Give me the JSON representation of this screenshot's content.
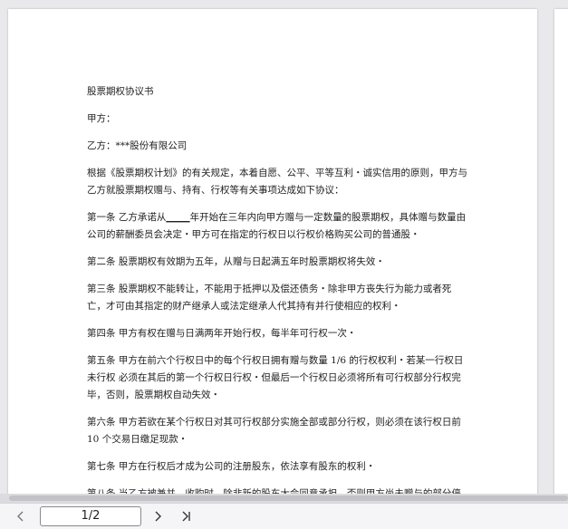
{
  "document": {
    "title": "股票期权协议书",
    "party_a": "甲方：",
    "party_b": "乙方：***股份有限公司",
    "intro": "根据《股票期权计划》的有关规定，本着自愿、公平、平等互利・诚实信用的原则，甲方与乙方就股票期权赠与、持有、行权等有关事项达成如下协议：",
    "a1_pre": "第一条 乙方承诺从",
    "a1_blank": "_____",
    "a1_post": "年开始在三年内向甲方赠与一定数量的股票期权，具体赠与数量由公司的薪酬委员会决定・甲方可在指定的行权日以行权价格购买公司的普通股・",
    "a2": "第二条 股票期权有效期为五年，从赠与日起满五年时股票期权将失效・",
    "a3": "第三条 股票期权不能转让，不能用于抵押以及偿还债务・除非甲方丧失行为能力或者死亡，才可由其指定的财产继承人或法定继承人代其持有并行使相应的权利・",
    "a4": "第四条 甲方有权在赠与日满两年开始行权，每半年可行权一次・",
    "a5": "第五条 甲方在前六个行权日中的每个行权日拥有赠与数量 1/6 的行权权利・若某一行权日未行权 必须在其后的第一个行权日行权・但最后一个行权日必须将所有可行权部分行权完毕，否则，股票期权自动失效・",
    "a6": "第六条 甲方若欲在某个行权日对其可行权部分实施全部或部分行权，则必须在该行权日前 10 个交易日缴足现款・",
    "a7": "第七条 甲方在行权后才成为公司的注册股东，依法享有股东的权利・",
    "a8": "第八条 当乙方被兼并、收购时，除非新的股东大会同意承担，否则甲方尚未赠与的部分停止赠与，已赠与未行权的部分必须立即行权・"
  },
  "toolbar": {
    "prev_icon": "chevron-left",
    "page_indicator": "1/2",
    "next_icon": "chevron-right",
    "last_icon": "skip-to-last"
  }
}
